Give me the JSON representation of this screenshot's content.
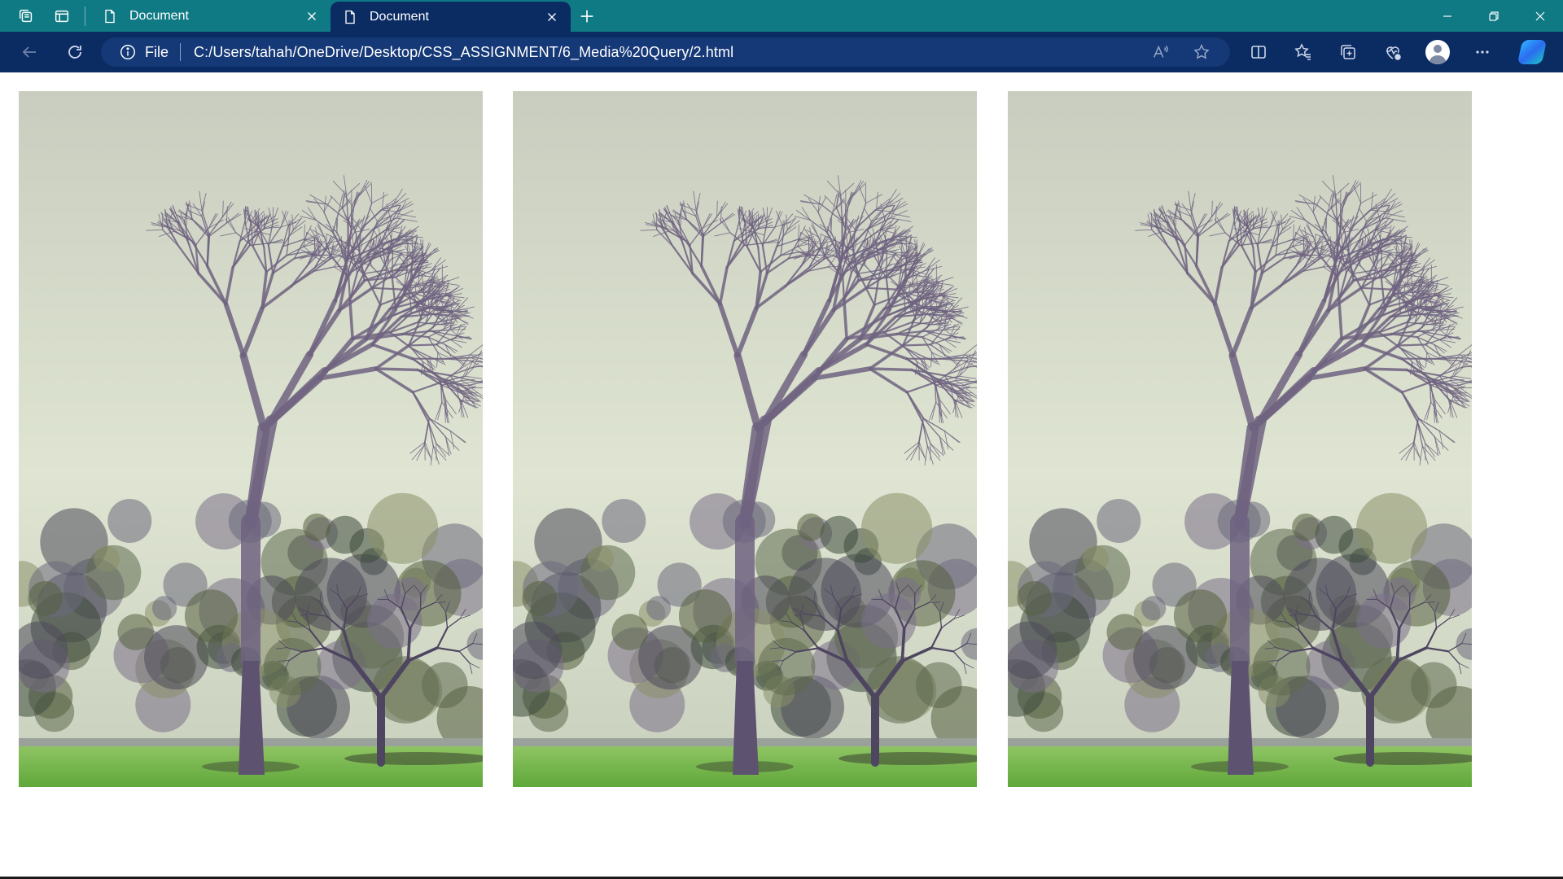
{
  "browser": {
    "tabs": [
      {
        "title": "Document",
        "active": false
      },
      {
        "title": "Document",
        "active": true
      }
    ],
    "address": {
      "scheme_label": "File",
      "url": "C:/Users/tahah/OneDrive/Desktop/CSS_ASSIGNMENT/6_Media%20Query/2.html"
    },
    "toolbar_icons": [
      "back-icon",
      "refresh-icon",
      "read-aloud-icon",
      "favorite-star-icon",
      "split-screen-icon",
      "favorites-icon",
      "collections-icon",
      "browser-essentials-icon",
      "profile-avatar",
      "more-icon",
      "copilot-icon"
    ],
    "colors": {
      "tabstrip": "#0f7a84",
      "toolbar": "#0b2b63",
      "omnibox": "#153877"
    }
  },
  "page": {
    "images": [
      {
        "subject": "bare tree in park"
      },
      {
        "subject": "bare tree in park"
      },
      {
        "subject": "bare tree in park"
      }
    ]
  }
}
